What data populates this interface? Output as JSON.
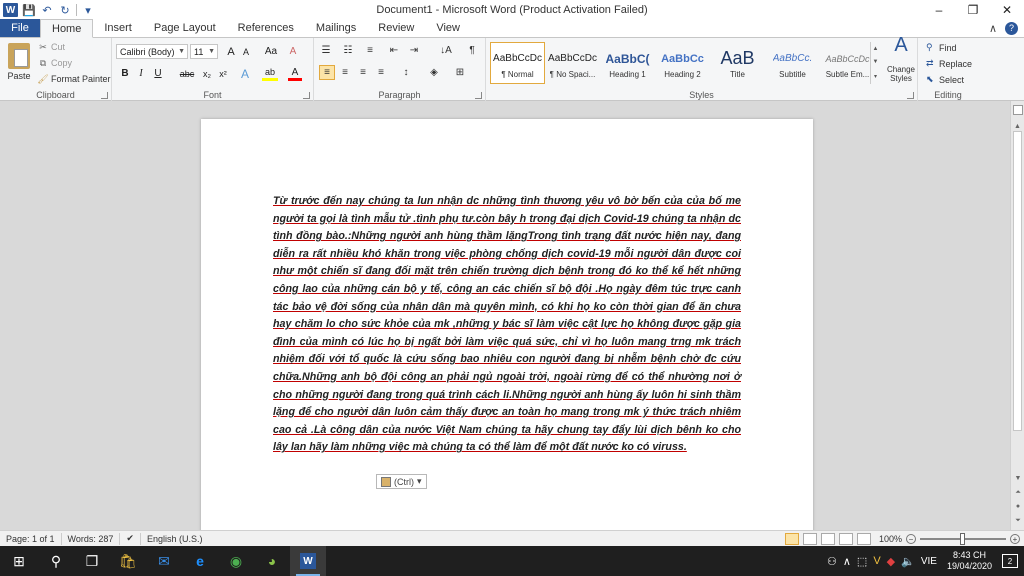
{
  "window": {
    "title": "Document1 - Microsoft Word (Product Activation Failed)",
    "minimize": "–",
    "maximize": "❐",
    "close": "✕"
  },
  "qat": {
    "app_icon": "W",
    "save": "💾",
    "undo": "↶",
    "redo": "↻",
    "customize": "▾"
  },
  "tabs": {
    "file": "File",
    "items": [
      "Home",
      "Insert",
      "Page Layout",
      "References",
      "Mailings",
      "Review",
      "View"
    ],
    "active": "Home",
    "collapse": "∧",
    "help": "?"
  },
  "clipboard": {
    "paste": "Paste",
    "cut": "Cut",
    "copy": "Copy",
    "format_painter": "Format Painter",
    "label": "Clipboard"
  },
  "font": {
    "family": "Calibri (Body)",
    "size": "11",
    "grow": "A",
    "shrink": "A",
    "change_case": "Aa",
    "clear": "A",
    "bold": "B",
    "italic": "I",
    "underline": "U",
    "strike": "abc",
    "subscript": "x₂",
    "superscript": "x²",
    "text_effects": "A",
    "highlight": "ab",
    "font_color": "A",
    "label": "Font"
  },
  "paragraph": {
    "label": "Paragraph",
    "sort": "↓A",
    "pilcrow": "¶"
  },
  "styles": {
    "label": "Styles",
    "items": [
      {
        "preview": "AaBbCcDc",
        "name": "¶ Normal"
      },
      {
        "preview": "AaBbCcDc",
        "name": "¶ No Spaci..."
      },
      {
        "preview": "AaBbC(",
        "name": "Heading 1"
      },
      {
        "preview": "AaBbCc",
        "name": "Heading 2"
      },
      {
        "preview": "AaB",
        "name": "Title"
      },
      {
        "preview": "AaBbCc.",
        "name": "Subtitle"
      },
      {
        "preview": "AaBbCcDc",
        "name": "Subtle Em..."
      }
    ],
    "change_styles": "Change Styles"
  },
  "editing": {
    "label": "Editing",
    "find": "Find",
    "replace": "Replace",
    "select": "Select"
  },
  "document": {
    "text": "Từ trước đến nay chúng ta lun nhận dc những tình thương yêu vô bờ bến của của bố me người ta gọi là tình mẫu tử .tình phụ tư.còn bây h trong đại dịch Covid-19 chúng ta nhận dc tình đồng bào.:Những người anh hùng thầm lặngTrong tình trạng đất nước hiện nay, đang diễn ra rất nhiều khó khăn trong việc phòng chống dịch covid-19 mỗi người dân được coi như một chiến sĩ đang đối mặt trên chiến trường dịch bệnh trong đó ko thể kể hết những công lao của những cán bộ y tế, công an các chiến sĩ bộ đội .Họ ngày đêm túc trực canh tác bảo vệ đời sống của nhân dân mà quyên mình, có khi họ ko còn thời gian để ăn chưa hay chăm lo cho sức khỏe của mk ,những y bác sĩ làm việc cật lực họ không được gặp gia đình của mình có lúc họ bị ngất bởi làm việc quá sức, chỉ vì họ luôn mang trng mk trách nhiệm đối với tổ quốc là cứu sống bao nhiêu con người đang bị nhễm bệnh chờ đc cứu chữa.Những anh bộ đội công an phải ngủ ngoài trời, ngoài rừng để có thể nhường nơi ở cho những người đang trong quá trình cách li.Những người anh hùng ấy luôn hi sinh thầm lặng để cho người dân luôn cảm thấy được an toàn họ mang trong mk ý thức trách nhiêm cao cả .Là công dân của nước Việt Nam chúng ta hãy chung tay đẩy lùi dịch bênh ko cho lây lan hãy làm những việc mà chúng ta có thể làm để một đất nước ko có viruss.",
    "paste_options": "(Ctrl)"
  },
  "status": {
    "page": "Page: 1 of 1",
    "words": "Words: 287",
    "language": "English (U.S.)",
    "zoom": "100%",
    "zoom_fraction": 0.5
  },
  "taskbar": {
    "language": "VIE",
    "time": "8:43 CH",
    "date": "19/04/2020",
    "notifications": "2"
  }
}
